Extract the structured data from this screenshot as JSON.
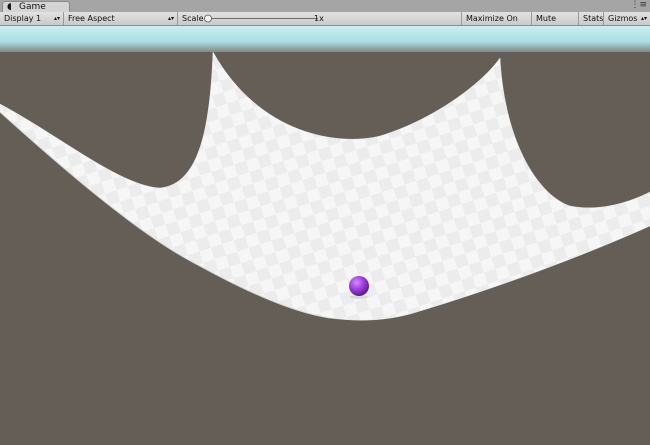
{
  "window": {
    "tab_label": "Game",
    "menu_icon": "dots-menu-icon"
  },
  "toolbar": {
    "display": "Display 1",
    "aspect": "Free Aspect",
    "scale_label": "Scale",
    "scale_value": "1x",
    "maximize_label": "Maximize On Play",
    "mute_label": "Mute Audio",
    "stats_label": "Stats",
    "gizmos_label": "Gizmos"
  },
  "scene": {
    "background_color": "#655e57",
    "sky_color": "#bde7ea",
    "mesh_color": "#f4f4f4",
    "ball_color": "#a03ee0"
  }
}
